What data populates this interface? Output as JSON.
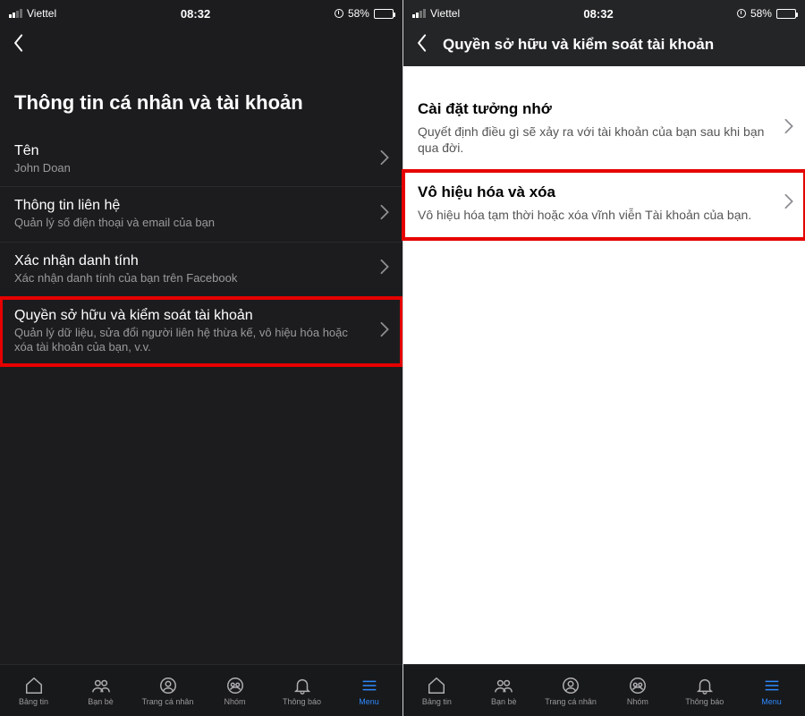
{
  "status": {
    "carrier": "Viettel",
    "time": "08:32",
    "battery_pct": "58%"
  },
  "left": {
    "page_title": "Thông tin cá nhân và tài khoản",
    "rows": [
      {
        "label": "Tên",
        "sub": "John Doan"
      },
      {
        "label": "Thông tin liên hệ",
        "sub": "Quản lý số điện thoại và email của bạn"
      },
      {
        "label": "Xác nhận danh tính",
        "sub": "Xác nhận danh tính của bạn trên Facebook"
      },
      {
        "label": "Quyền sở hữu và kiểm soát tài khoản",
        "sub": "Quản lý dữ liệu, sửa đổi người liên hệ thừa kế, vô hiệu hóa hoặc xóa tài khoản của bạn, v.v."
      }
    ]
  },
  "right": {
    "nav_title": "Quyền sở hữu và kiểm soát tài khoản",
    "rows": [
      {
        "label": "Cài đặt tưởng nhớ",
        "sub": "Quyết định điều gì sẽ xảy ra với tài khoản của bạn sau khi bạn qua đời."
      },
      {
        "label": "Vô hiệu hóa và xóa",
        "sub": "Vô hiệu hóa tạm thời hoặc xóa vĩnh viễn Tài khoản của bạn."
      }
    ]
  },
  "bottom_nav": {
    "items": [
      {
        "label": "Bảng tin"
      },
      {
        "label": "Bạn bè"
      },
      {
        "label": "Trang cá nhân"
      },
      {
        "label": "Nhóm"
      },
      {
        "label": "Thông báo"
      },
      {
        "label": "Menu"
      }
    ]
  }
}
